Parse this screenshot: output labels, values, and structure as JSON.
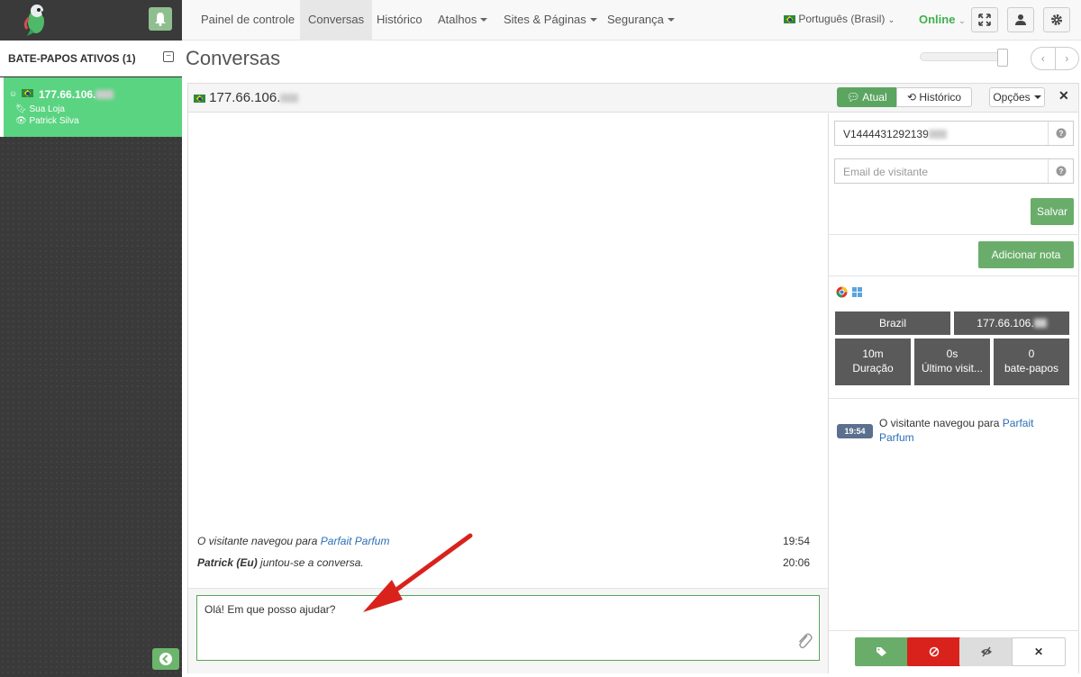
{
  "sidebar": {
    "chats_title": "BATE-PAPOS ATIVOS (1)",
    "active_chat": {
      "ip": "177.66.106.",
      "store": "Sua Loja",
      "operator": "Patrick Silva"
    }
  },
  "navbar": {
    "items": [
      "Painel de controle",
      "Conversas",
      "Histórico",
      "Atalhos",
      "Sites & Páginas",
      "Segurança"
    ],
    "language": "Português (Brasil)",
    "status": "Online"
  },
  "page": {
    "title": "Conversas"
  },
  "chat": {
    "ip": "177.66.106.",
    "tab_current": "Atual",
    "tab_history": "Histórico",
    "options_label": "Opções",
    "messages": [
      {
        "prefix": "O visitante navegou para ",
        "link": "Parfait Parfum",
        "bold": "",
        "time": "19:54"
      },
      {
        "prefix": "",
        "bold": "Patrick (Eu)",
        "suffix": " juntou-se a conversa.",
        "time": "20:06"
      }
    ],
    "composer_value": "Olá! Em que posso ajudar?"
  },
  "info": {
    "visitor_id": "V1444431292139",
    "email_placeholder": "Email de visitante",
    "save_label": "Salvar",
    "add_note_label": "Adicionar nota",
    "country": "Brazil",
    "ip": "177.66.106.",
    "duration_value": "10m",
    "duration_label": "Duração",
    "last_visit_value": "0s",
    "last_visit_label": "Último visit...",
    "chats_value": "0",
    "chats_label": "bate-papos",
    "event_time": "19:54",
    "event_text": "O visitante navegou para ",
    "event_link": "Parfait Parfum"
  },
  "colors": {
    "accent_green": "#5ad481",
    "online_green": "#3fb04d",
    "button_green": "#6aad6a",
    "danger_red": "#d9534f"
  }
}
